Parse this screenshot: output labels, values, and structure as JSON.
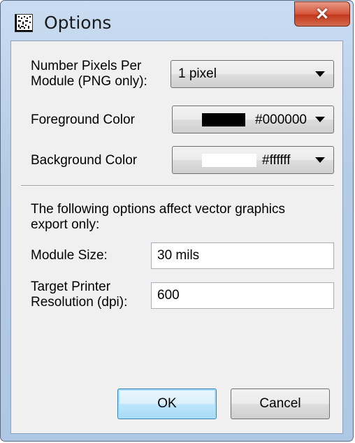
{
  "window": {
    "title": "Options",
    "close_glyph": "✕"
  },
  "fields": {
    "pixels_per_module": {
      "label_line1": "Number Pixels Per",
      "label_line2": "Module (PNG only):",
      "value": "1 pixel"
    },
    "foreground_color": {
      "label": "Foreground Color",
      "value": "#000000",
      "swatch": "#000000"
    },
    "background_color": {
      "label": "Background Color",
      "value": "#ffffff",
      "swatch": "#ffffff"
    },
    "vector_note": {
      "line1": "The following options affect vector graphics",
      "line2": "export only:"
    },
    "module_size": {
      "label": "Module Size:",
      "value": "30 mils"
    },
    "printer_resolution": {
      "label_line1": "Target Printer",
      "label_line2": "Resolution (dpi):",
      "value": "600"
    }
  },
  "buttons": {
    "ok": "OK",
    "cancel": "Cancel"
  }
}
